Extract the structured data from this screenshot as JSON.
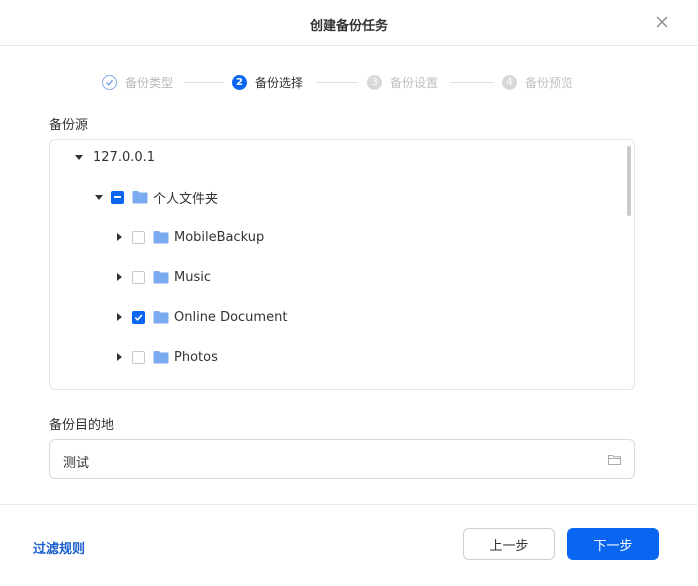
{
  "dialog": {
    "title": "创建备份任务"
  },
  "steps": [
    {
      "number": "✓",
      "label": "备份类型",
      "state": "done"
    },
    {
      "number": "2",
      "label": "备份选择",
      "state": "active"
    },
    {
      "number": "3",
      "label": "备份设置",
      "state": "todo"
    },
    {
      "number": "4",
      "label": "备份预览",
      "state": "todo"
    }
  ],
  "source": {
    "label": "备份源",
    "tree": {
      "root": "127.0.0.1",
      "folder": "个人文件夹",
      "children": [
        {
          "name": "MobileBackup",
          "checked": false
        },
        {
          "name": "Music",
          "checked": false
        },
        {
          "name": "Online Document",
          "checked": true
        },
        {
          "name": "Photos",
          "checked": false
        }
      ]
    }
  },
  "destination": {
    "label": "备份目的地",
    "value": "测试"
  },
  "footer": {
    "filter_link": "过滤规则",
    "prev_button": "上一步",
    "next_button": "下一步"
  },
  "colors": {
    "accent": "#0a66f0",
    "link": "#1a5fd0",
    "folder": "#7aaaf0"
  }
}
